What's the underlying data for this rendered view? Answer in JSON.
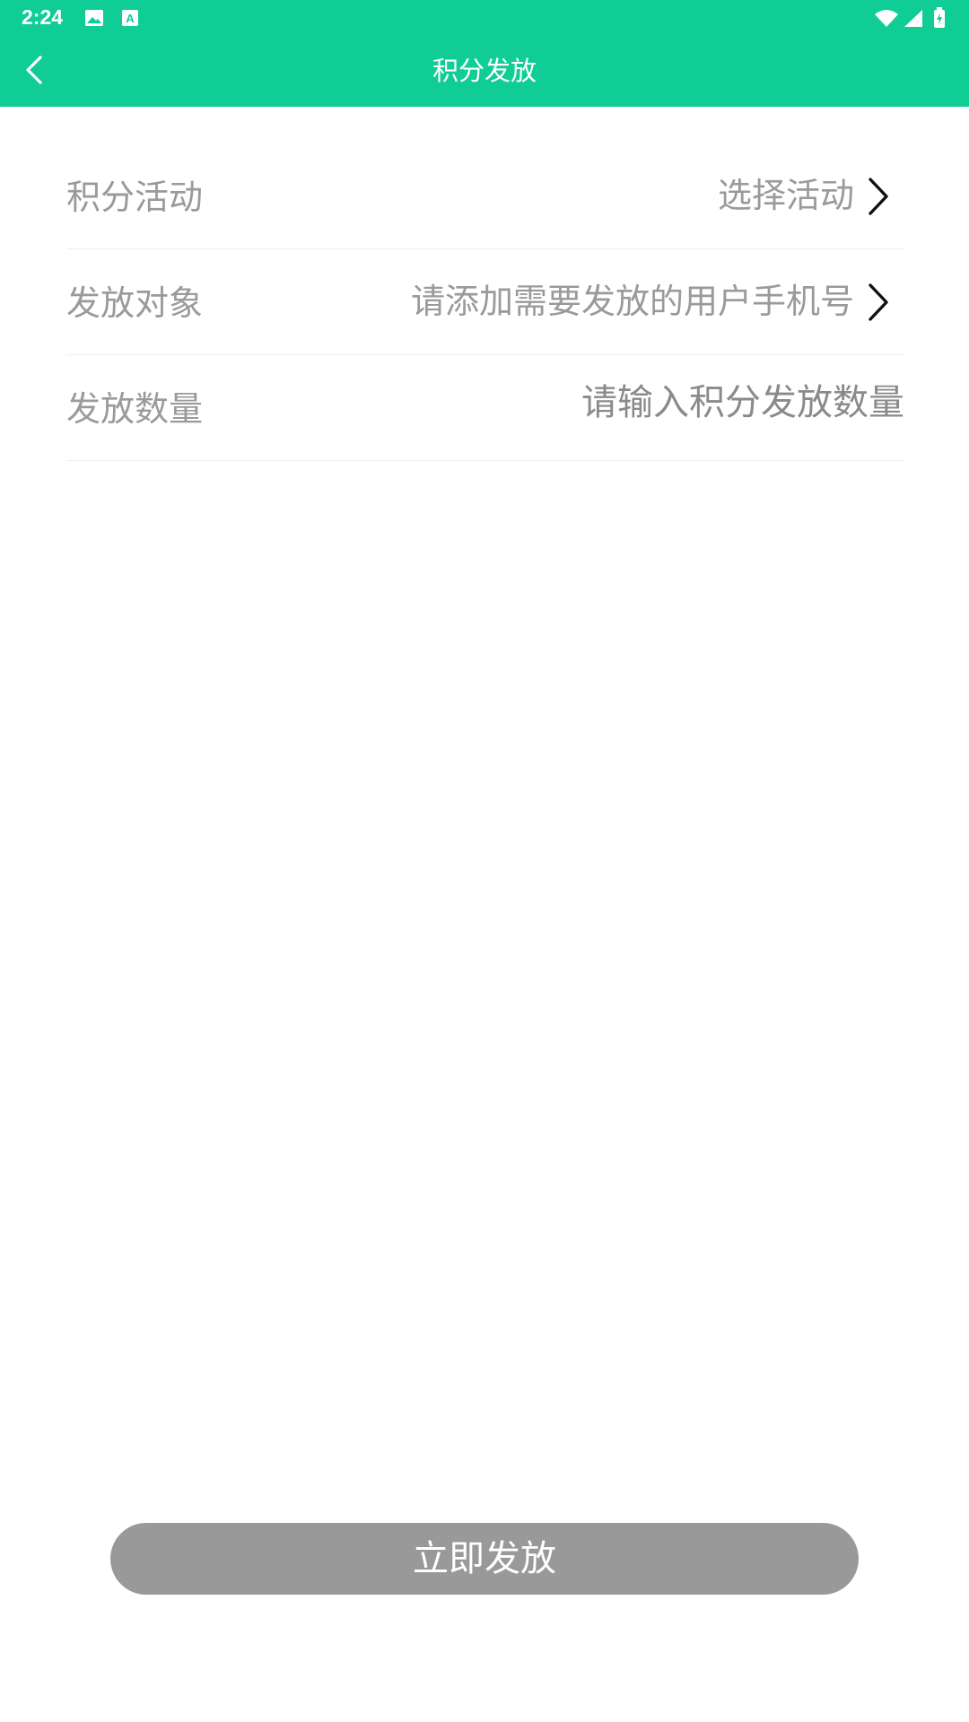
{
  "status_bar": {
    "time": "2:24",
    "icons": [
      "image-icon",
      "a-notification-icon",
      "wifi-icon",
      "signal-icon",
      "battery-icon"
    ]
  },
  "header": {
    "title": "积分发放",
    "back_icon": "chevron-left-icon",
    "color": "#0fcd94"
  },
  "form": {
    "activity": {
      "label": "积分活动",
      "value": "选择活动"
    },
    "recipients": {
      "label": "发放对象",
      "value": "请添加需要发放的用户手机号"
    },
    "amount": {
      "label": "发放数量",
      "placeholder": "请输入积分发放数量",
      "value": ""
    }
  },
  "submit": {
    "label": "立即发放",
    "color": "#999999"
  }
}
